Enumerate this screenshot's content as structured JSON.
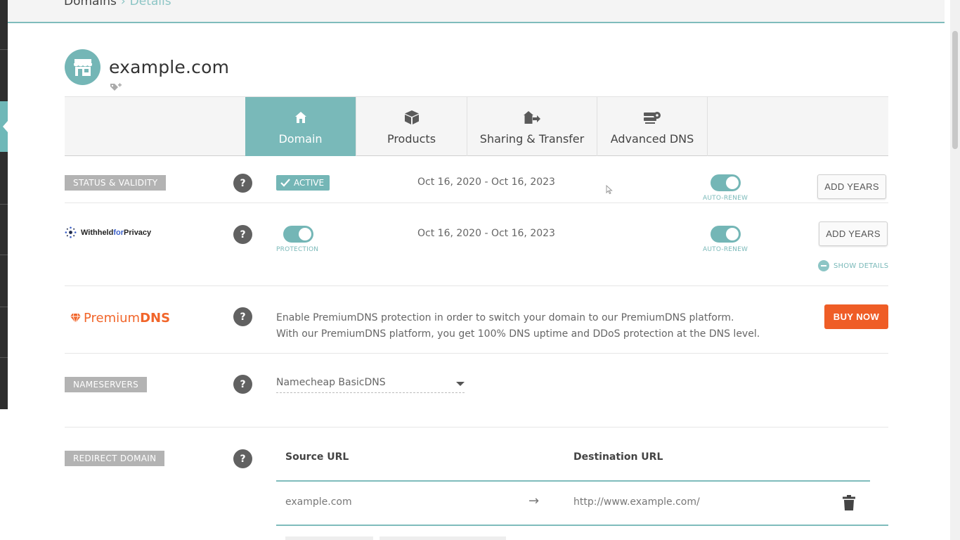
{
  "breadcrumb": {
    "first": "Domains",
    "separator": "›",
    "current": "Details"
  },
  "domain": {
    "name": "example.com"
  },
  "tabs": [
    {
      "label": "Domain",
      "icon": "home-icon",
      "active": true
    },
    {
      "label": "Products",
      "icon": "box-icon",
      "active": false
    },
    {
      "label": "Sharing & Transfer",
      "icon": "house-arrow-icon",
      "active": false
    },
    {
      "label": "Advanced DNS",
      "icon": "server-gear-icon",
      "active": false
    }
  ],
  "status": {
    "section_label": "STATUS & VALIDITY",
    "help": "?",
    "badge": "ACTIVE",
    "dates": "Oct 16, 2020 - Oct 16, 2023",
    "autorenew_label": "AUTO-RENEW",
    "add_years": "ADD YEARS"
  },
  "privacy": {
    "logo_text_a": "Withheld",
    "logo_text_b": "for",
    "logo_text_c": "Privacy",
    "help": "?",
    "protection_label": "PROTECTION",
    "dates": "Oct 16, 2020 - Oct 16, 2023",
    "autorenew_label": "AUTO-RENEW",
    "add_years": "ADD YEARS",
    "show_details": "SHOW DETAILS"
  },
  "premium": {
    "logo_a": "Premium",
    "logo_b": "DNS",
    "help": "?",
    "line1": "Enable PremiumDNS protection in order to switch your domain to our PremiumDNS platform.",
    "line2": "With our PremiumDNS platform, you get 100% DNS uptime and DDoS protection at the DNS level.",
    "buy": "BUY NOW"
  },
  "nameservers": {
    "section_label": "NAMESERVERS",
    "help": "?",
    "selected": "Namecheap BasicDNS"
  },
  "redirect": {
    "section_label": "REDIRECT DOMAIN",
    "help": "?",
    "source_header": "Source URL",
    "destination_header": "Destination URL",
    "source": "example.com",
    "arrow": "→",
    "destination": "http://www.example.com/"
  },
  "colors": {
    "accent": "#74b6b6",
    "buy": "#ef5d26",
    "premium_brand": "#f1652a",
    "tag_gray": "#b3b3b3"
  }
}
